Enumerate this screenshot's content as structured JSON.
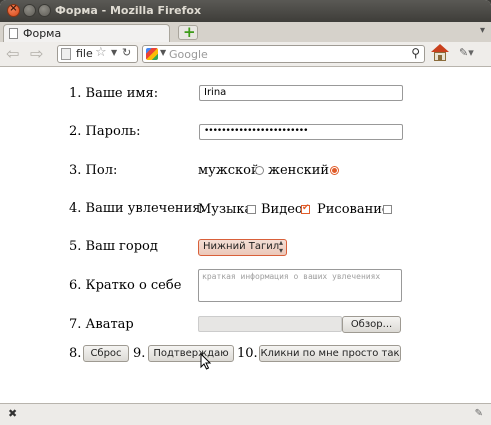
{
  "window": {
    "title": "Форма - Mozilla Firefox"
  },
  "tabs": [
    {
      "label": "Форма"
    }
  ],
  "navbar": {
    "url": "file",
    "search_placeholder": "Google"
  },
  "form": {
    "name_label": "1. Ваше имя:",
    "name_value": "Irina",
    "password_label": "2. Пароль:",
    "password_value": "••••••••••••••••••••••••",
    "gender_label": "3. Пол:",
    "gender_male": "мужской",
    "gender_female": "женский",
    "gender_selected": "женский",
    "hobbies_label": "4. Ваши увлечения:",
    "hobby_music": "Музыка",
    "hobby_video": "Видео",
    "hobby_drawing": "Рисование",
    "hobbies_checked": [
      "Видео"
    ],
    "city_label": "5. Ваш город",
    "city_value": "Нижний Тагил",
    "about_label": "6. Кратко о себе",
    "about_placeholder": "краткая информация о ваших увлечениях",
    "avatar_label": "7. Аватар",
    "browse_button": "Обзор...",
    "n8": "8.",
    "reset_button": "Сброс",
    "n9": "9.",
    "confirm_button": "Подтверждаю",
    "n10": "10.",
    "just_click_button": "Кликни по мне просто так"
  },
  "colors": {
    "accent": "#e05c2a",
    "titlebar": "#3e3d39"
  }
}
